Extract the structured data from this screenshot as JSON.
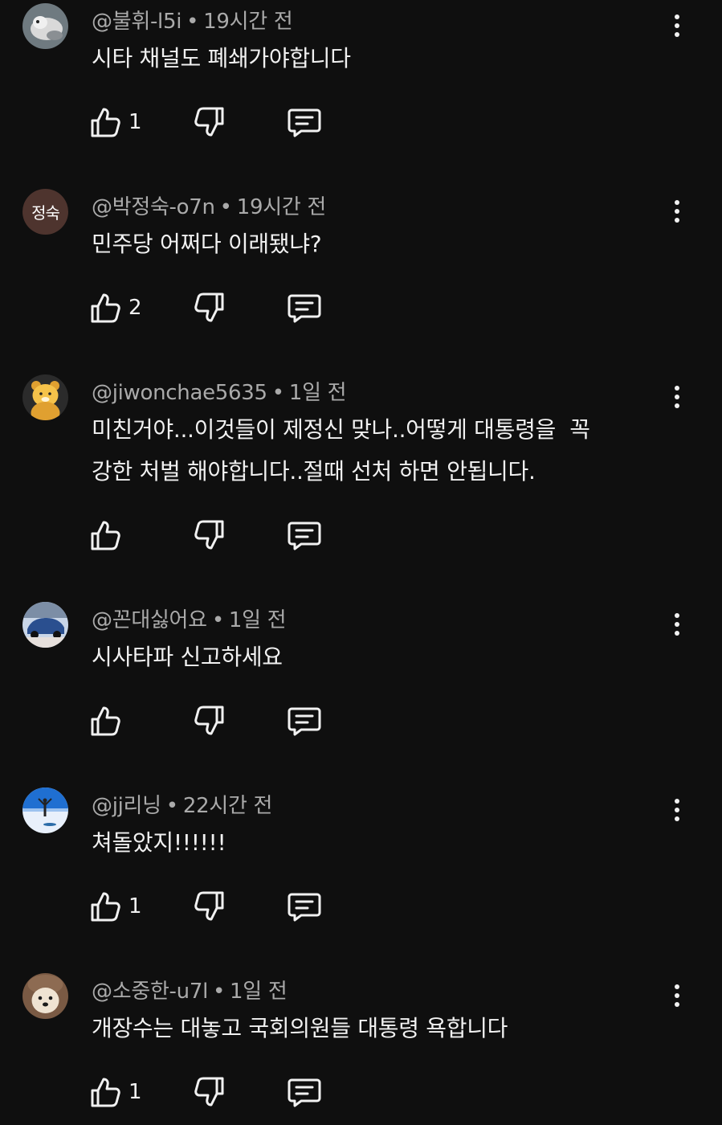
{
  "comments": [
    {
      "author": "@불휘-l5i",
      "time": "19시간 전",
      "text": [
        "시타 채널도 폐쇄가야합니다"
      ],
      "likes": "1",
      "avatar": {
        "type": "photo",
        "icon": "dog-photo-avatar",
        "colors": [
          "#6f7a80",
          "#d9d9d9"
        ]
      }
    },
    {
      "author": "@박정숙-o7n",
      "time": "19시간 전",
      "text": [
        "민주당 어쩌다 이래됐냐?"
      ],
      "likes": "2",
      "avatar": {
        "type": "text",
        "label": "정숙",
        "color": "#4e342e"
      }
    },
    {
      "author": "@jiwonchae5635",
      "time": "1일 전",
      "text": [
        "미친거야...이것들이 제정신 맞나..어떻게 대통령을  꼭",
        "강한 처벌 해야합니다..절때 선처 하면 안됩니다."
      ],
      "likes": "",
      "avatar": {
        "type": "photo",
        "icon": "bear-character-avatar",
        "colors": [
          "#e0a030",
          "#f5c24a"
        ]
      }
    },
    {
      "author": "@꼰대싫어요",
      "time": "1일 전",
      "text": [
        "시사타파 신고하세요"
      ],
      "likes": "",
      "avatar": {
        "type": "photo",
        "icon": "car-photo-avatar",
        "colors": [
          "#2a4f8f",
          "#c9d6e8"
        ]
      }
    },
    {
      "author": "@jj리닝",
      "time": "22시간 전",
      "text": [
        "쳐돌았지!!!!!!"
      ],
      "likes": "1",
      "avatar": {
        "type": "photo",
        "icon": "person-sky-avatar",
        "colors": [
          "#1f6fd1",
          "#e8f0fb"
        ]
      }
    },
    {
      "author": "@소중한-u7l",
      "time": "1일 전",
      "text": [
        "개장수는 대놓고 국회의원들 대통령 욕합니다"
      ],
      "likes": "1",
      "avatar": {
        "type": "photo",
        "icon": "puppy-photo-avatar",
        "colors": [
          "#7a5a44",
          "#efe3d2"
        ]
      }
    }
  ],
  "ui": {
    "separator": "•",
    "icons": {
      "like": "thumbs-up-icon",
      "dislike": "thumbs-down-icon",
      "reply": "reply-icon",
      "more": "more-vertical-icon"
    }
  }
}
